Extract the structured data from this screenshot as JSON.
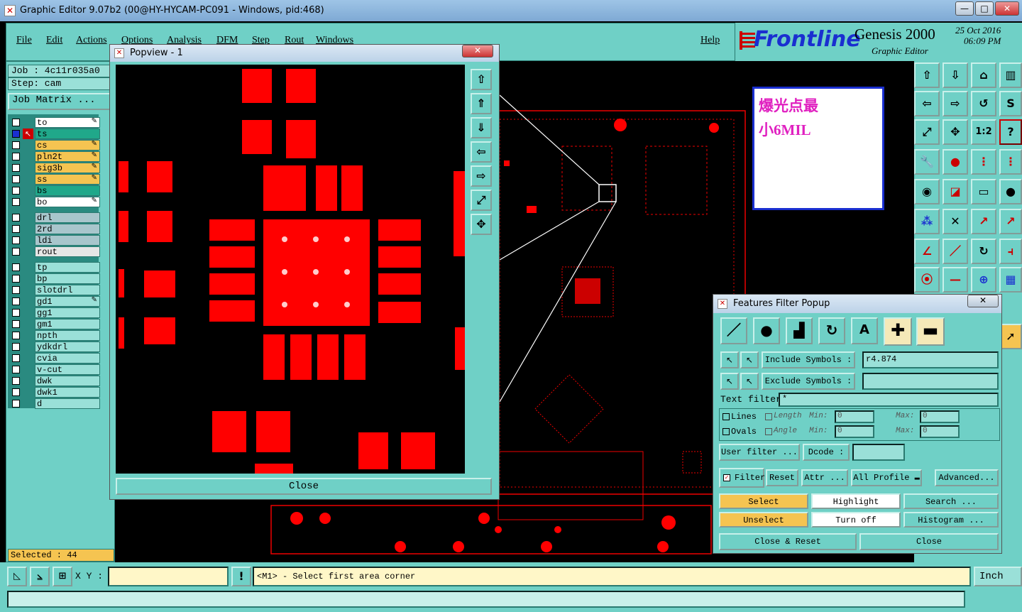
{
  "window": {
    "title": "Graphic Editor 9.07b2 (00@HY-HYCAM-PC091 - Windows, pid:468)",
    "min": "—",
    "max": "□",
    "close": "✕"
  },
  "menu": {
    "items": [
      "File",
      "Edit",
      "Actions",
      "Options",
      "Analysis",
      "DFM",
      "Step",
      "Rout",
      "Windows"
    ],
    "help": "Help"
  },
  "brand": {
    "logo": "Frontline",
    "product": "Genesis 2000",
    "subtitle": "Graphic Editor",
    "date": "25 Oct 2016",
    "time": "06:09 PM"
  },
  "job": {
    "job_label": "Job : 4c11r035a0",
    "step_label": "Step: cam",
    "matrix_button": "Job Matrix ..."
  },
  "layers": [
    {
      "name": "to",
      "color": "#ffffff",
      "edit": true
    },
    {
      "name": "ts",
      "color": "#20a88a",
      "edit": false,
      "active": true
    },
    {
      "name": "cs",
      "color": "#f5c451",
      "edit": true
    },
    {
      "name": "pln2t",
      "color": "#f5c451",
      "edit": true
    },
    {
      "name": "sig3b",
      "color": "#f5c451",
      "edit": true
    },
    {
      "name": "ss",
      "color": "#f5c451",
      "edit": true
    },
    {
      "name": "bs",
      "color": "#20a88a",
      "edit": false
    },
    {
      "name": "bo",
      "color": "#ffffff",
      "edit": true
    },
    {
      "name": "drl",
      "color": "#a8c6cc",
      "edit": false
    },
    {
      "name": "2rd",
      "color": "#a8c6cc",
      "edit": false
    },
    {
      "name": "ldi",
      "color": "#a8c6cc",
      "edit": false
    },
    {
      "name": "rout",
      "color": "#e6e6e6",
      "edit": false
    },
    {
      "name": "tp",
      "color": "#9ae0d8",
      "edit": false
    },
    {
      "name": "bp",
      "color": "#9ae0d8",
      "edit": false
    },
    {
      "name": "slotdrl",
      "color": "#9ae0d8",
      "edit": false
    },
    {
      "name": "gd1",
      "color": "#9ae0d8",
      "edit": true
    },
    {
      "name": "gg1",
      "color": "#9ae0d8",
      "edit": false
    },
    {
      "name": "gm1",
      "color": "#9ae0d8",
      "edit": false
    },
    {
      "name": "npth",
      "color": "#9ae0d8",
      "edit": false
    },
    {
      "name": "ydkdrl",
      "color": "#9ae0d8",
      "edit": false
    },
    {
      "name": "cvia",
      "color": "#9ae0d8",
      "edit": false
    },
    {
      "name": "v-cut",
      "color": "#9ae0d8",
      "edit": false
    },
    {
      "name": "dwk",
      "color": "#9ae0d8",
      "edit": false
    },
    {
      "name": "dwk1",
      "color": "#9ae0d8",
      "edit": false
    },
    {
      "name": "d",
      "color": "#9ae0d8",
      "edit": false
    }
  ],
  "selected": "Selected : 44",
  "note": {
    "line1": "爆光点最",
    "line2": "小6MIL"
  },
  "popview": {
    "title": "Popview - 1",
    "close_label": "Close"
  },
  "filter": {
    "title": "Features Filter Popup",
    "include_label": "Include Symbols :",
    "include_value": "r4.874",
    "exclude_label": "Exclude Symbols :",
    "exclude_value": "",
    "text_filter_label": "Text filter",
    "text_filter_value": "*",
    "lines_label": "Lines",
    "ovals_label": "Ovals",
    "length_label": "Length",
    "angle_label": "Angle",
    "min_label": "Min:",
    "max_label": "Max:",
    "length_min": "0",
    "length_max": "0",
    "angle_min": "0",
    "angle_max": "0",
    "user_filter": "User filter ...",
    "dcode": "Dcode :",
    "filter_label": "Filter",
    "reset": "Reset",
    "attr": "Attr ...",
    "profile": "All Profile",
    "advanced": "Advanced...",
    "select": "Select",
    "highlight": "Highlight",
    "search": "Search ...",
    "unselect": "Unselect",
    "turn_off": "Turn off",
    "histogram": "Histogram ...",
    "close_reset": "Close & Reset",
    "close": "Close"
  },
  "status": {
    "xy_label": "X Y :",
    "message": "<M1> - Select first area corner",
    "units": "Inch"
  }
}
